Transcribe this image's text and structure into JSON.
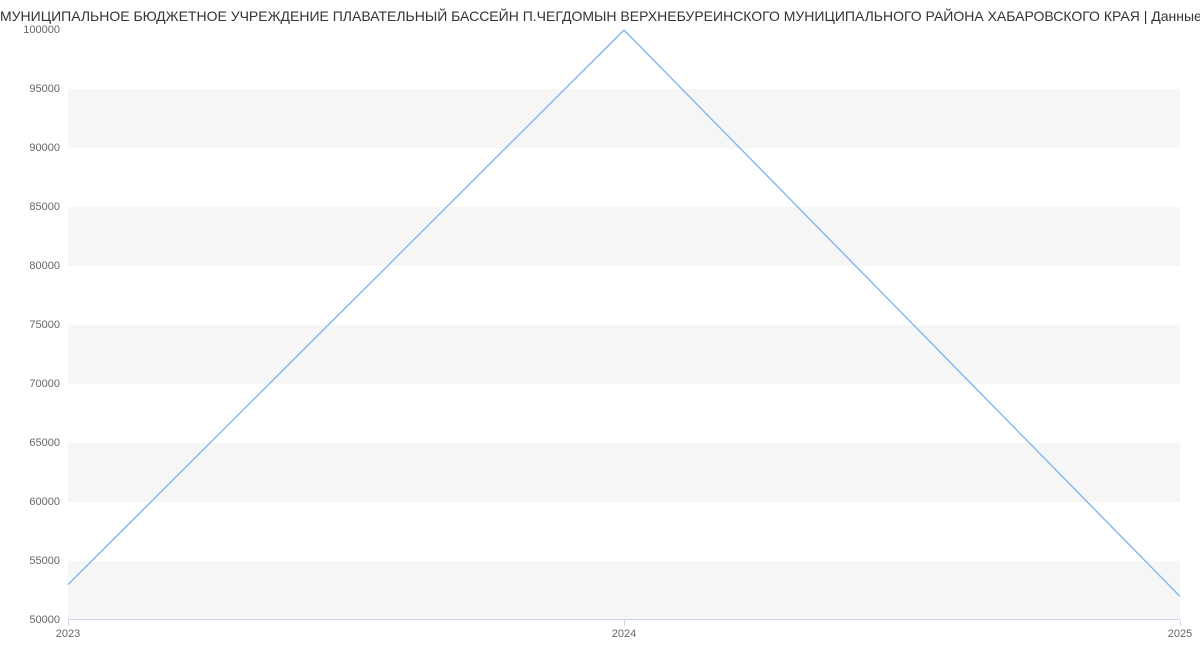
{
  "chart_data": {
    "type": "line",
    "title": "МУНИЦИПАЛЬНОЕ БЮДЖЕТНОЕ УЧРЕЖДЕНИЕ ПЛАВАТЕЛЬНЫЙ БАССЕЙН П.ЧЕГДОМЫН ВЕРХНЕБУРЕИНСКОГО МУНИЦИПАЛЬНОГО РАЙОНА ХАБАРОВСКОГО КРАЯ | Данные",
    "x": [
      "2023",
      "2024",
      "2025"
    ],
    "values": [
      53000,
      100000,
      52000
    ],
    "ylim": [
      50000,
      100000
    ],
    "y_ticks": [
      50000,
      55000,
      60000,
      65000,
      70000,
      75000,
      80000,
      85000,
      90000,
      95000,
      100000
    ],
    "xlabel": "",
    "ylabel": "",
    "line_color": "#7cb5ec"
  }
}
